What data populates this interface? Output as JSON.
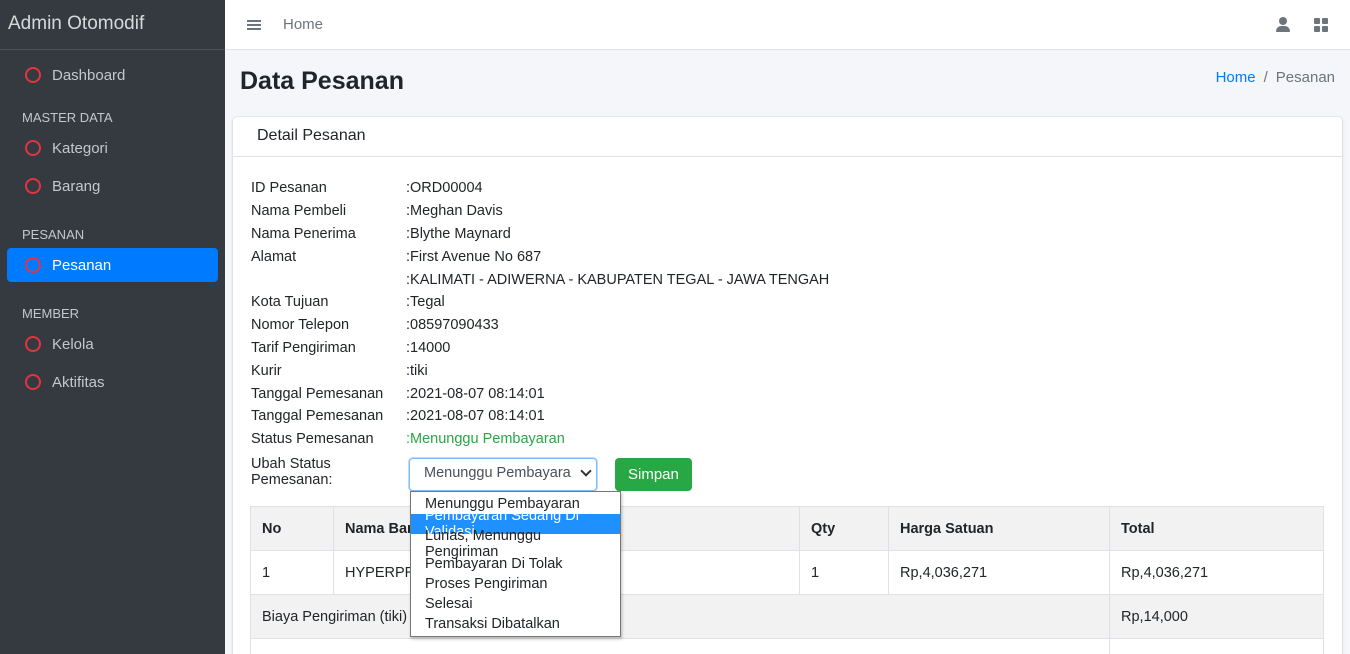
{
  "sidebar": {
    "brand": "Admin Otomodif",
    "dashboard": "Dashboard",
    "sections": {
      "master": "MASTER DATA",
      "pesanan": "PESANAN",
      "member": "MEMBER"
    },
    "kategori": "Kategori",
    "barang": "Barang",
    "pesanan": "Pesanan",
    "kelola": "Kelola",
    "aktifitas": "Aktifitas"
  },
  "topbar": {
    "home": "Home"
  },
  "header": {
    "title": "Data Pesanan",
    "breadcrumb": {
      "home": "Home",
      "separator": "/",
      "current": "Pesanan"
    }
  },
  "card": {
    "title": "Detail Pesanan",
    "details": [
      {
        "label": "ID Pesanan",
        "value": ":ORD00004"
      },
      {
        "label": "Nama Pembeli",
        "value": ":Meghan Davis"
      },
      {
        "label": "Nama Penerima",
        "value": ":Blythe Maynard"
      },
      {
        "label": "Alamat",
        "value": ":First Avenue No 687"
      },
      {
        "label": "",
        "value": ":KALIMATI - ADIWERNA - KABUPATEN TEGAL - JAWA TENGAH"
      },
      {
        "label": "Kota Tujuan",
        "value": ":Tegal"
      },
      {
        "label": "Nomor Telepon",
        "value": ":08597090433"
      },
      {
        "label": "Tarif Pengiriman",
        "value": ":14000"
      },
      {
        "label": "Kurir",
        "value": ":tiki"
      },
      {
        "label": "Tanggal Pemesanan",
        "value": ":2021-08-07 08:14:01"
      },
      {
        "label": "Tanggal Pemesanan",
        "value": ":2021-08-07 08:14:01"
      },
      {
        "label": "Status Pemesanan",
        "value": ":Menunggu Pembayaran"
      }
    ],
    "status_label": "Ubah Status Pemesanan:",
    "status_select": "Menunggu Pembayara",
    "save_button": "Simpan",
    "status_options": [
      "Menunggu Pembayaran",
      "Pembayaran Sedang Di Validasi",
      "Lunas, Menunggu Pengiriman",
      "Pembayaran Di Tolak",
      "Proses Pengiriman",
      "Selesai",
      "Transaksi Dibatalkan"
    ]
  },
  "table": {
    "headers": [
      "No",
      "Nama Barang",
      "Qty",
      "Harga Satuan",
      "Total"
    ],
    "row1": {
      "no": "1",
      "nama": "HYPERPRO",
      "qty": "1",
      "harga": "Rp,4,036,271",
      "total": "Rp,4,036,271"
    },
    "shipping": {
      "label": "Biaya Pengiriman (tiki)",
      "total": "Rp,14,000"
    }
  },
  "colors": {
    "sidebar_bg": "#343a40",
    "active": "#007bff",
    "success": "#28a745",
    "circle": "#e3343f"
  }
}
